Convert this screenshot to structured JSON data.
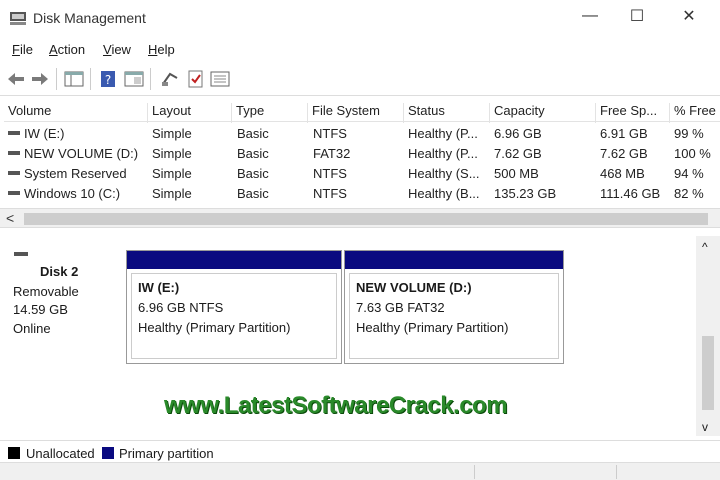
{
  "window": {
    "title": "Disk Management",
    "controls": {
      "minimize": "—",
      "maximize": "☐",
      "close": "✕"
    }
  },
  "menu": {
    "file": {
      "hotkey": "F",
      "rest": "ile"
    },
    "action": {
      "hotkey": "A",
      "rest": "ction"
    },
    "view": {
      "hotkey": "V",
      "rest": "iew"
    },
    "help": {
      "hotkey": "H",
      "rest": "elp"
    }
  },
  "volume_table": {
    "columns": [
      "Volume",
      "Layout",
      "Type",
      "File System",
      "Status",
      "Capacity",
      "Free Sp...",
      "% Free"
    ],
    "rows": [
      {
        "volume": "IW (E:)",
        "layout": "Simple",
        "type": "Basic",
        "fs": "NTFS",
        "status": "Healthy (P...",
        "capacity": "6.96 GB",
        "free": "6.91 GB",
        "pct": "99 %"
      },
      {
        "volume": "NEW VOLUME (D:)",
        "layout": "Simple",
        "type": "Basic",
        "fs": "FAT32",
        "status": "Healthy (P...",
        "capacity": "7.62 GB",
        "free": "7.62 GB",
        "pct": "100 %"
      },
      {
        "volume": "System Reserved",
        "layout": "Simple",
        "type": "Basic",
        "fs": "NTFS",
        "status": "Healthy (S...",
        "capacity": "500 MB",
        "free": "468 MB",
        "pct": "94 %"
      },
      {
        "volume": "Windows 10 (C:)",
        "layout": "Simple",
        "type": "Basic",
        "fs": "NTFS",
        "status": "Healthy (B...",
        "capacity": "135.23 GB",
        "free": "111.46 GB",
        "pct": "82 %"
      }
    ]
  },
  "disk": {
    "name": "Disk 2",
    "kind": "Removable",
    "size": "14.59 GB",
    "state": "Online"
  },
  "partitions": [
    {
      "name": "IW  (E:)",
      "size": "6.96 GB NTFS",
      "status": "Healthy (Primary Partition)"
    },
    {
      "name": "NEW VOLUME  (D:)",
      "size": "7.63 GB FAT32",
      "status": "Healthy (Primary Partition)"
    }
  ],
  "legend": {
    "unallocated": "Unallocated",
    "primary": "Primary partition",
    "unallocated_color": "#000000",
    "primary_color": "#0a0a80"
  },
  "watermark": "www.LatestSoftwareCrack.com",
  "scroll": {
    "left": "<",
    "up": "^",
    "down": "v"
  }
}
